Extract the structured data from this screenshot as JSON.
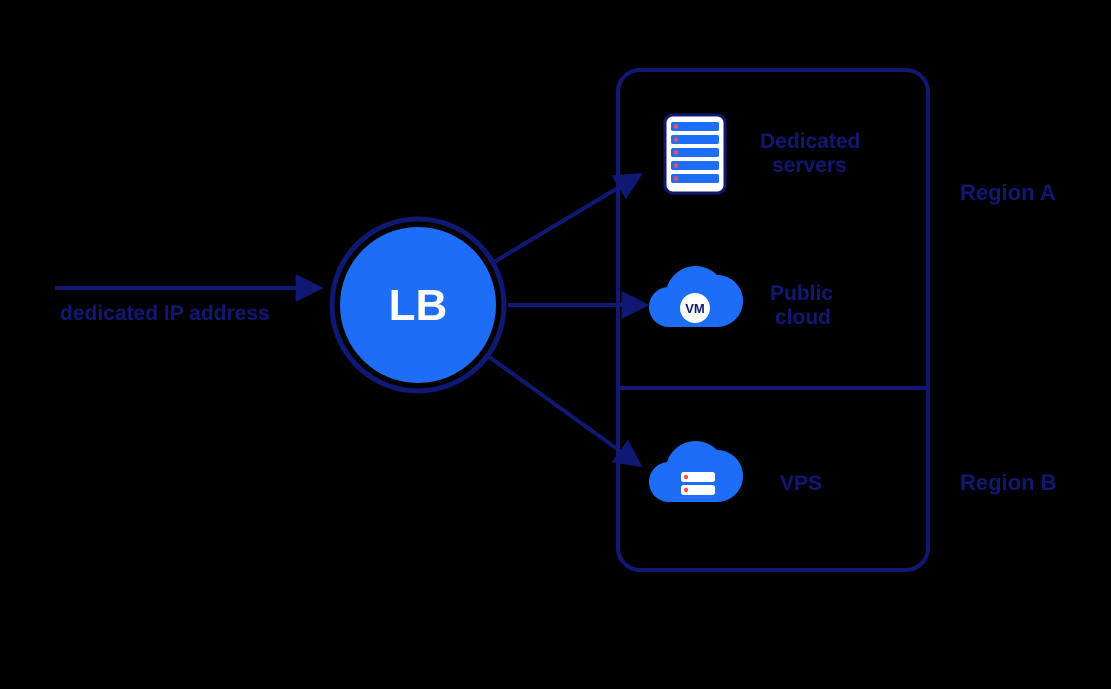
{
  "colors": {
    "stroke": "#0f1974",
    "fill_bright": "#1e6df6",
    "text_dark": "#0f1974",
    "text_white": "#ffffff",
    "accent_red": "#ff4d4d"
  },
  "incoming": {
    "label": "dedicated IP address"
  },
  "lb": {
    "label": "LB"
  },
  "targets": {
    "dedicated": {
      "label_line1": "Dedicated",
      "label_line2": "servers"
    },
    "public_cloud": {
      "label_line1": "Public",
      "label_line2": "cloud",
      "badge": "VM"
    },
    "vps": {
      "label": "VPS"
    }
  },
  "regions": {
    "a": "Region A",
    "b": "Region B"
  }
}
